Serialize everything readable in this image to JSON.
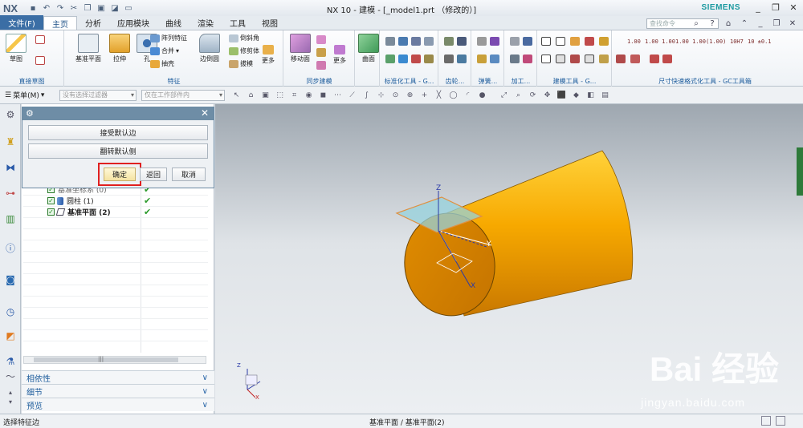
{
  "app": {
    "logo": "NX",
    "window_title": "NX 10 - 建模 - [_model1.prt （修改的）]",
    "brand": "SIEMENS",
    "search_placeholder": "查找命令"
  },
  "tabs": {
    "file": "文件(F)",
    "items": [
      "主页",
      "分析",
      "应用模块",
      "曲线",
      "渲染",
      "工具",
      "视图"
    ],
    "active": "主页"
  },
  "ribbon": {
    "sketch": {
      "btn1": "草图",
      "label": "直接草图"
    },
    "feature": {
      "datum_plane": "基准平面",
      "extrude": "拉伸",
      "hole": "孔",
      "pattern": "阵列特征",
      "unite": "合并",
      "shell": "抽壳",
      "edge_blend": "边倒圆",
      "chamfer": "倒斜角",
      "trim_body": "修剪体",
      "draft": "拔模",
      "more": "更多",
      "label": "特征"
    },
    "sync": {
      "move_face": "移动面",
      "more": "更多",
      "label": "同步建模"
    },
    "surface": {
      "face": "曲面"
    },
    "groups": {
      "std_tools": "标准化工具 - G...",
      "gear": "齿轮...",
      "spring": "弹簧...",
      "machining": "加工...",
      "modeling_tools": "建模工具 - G...",
      "dimension": "尺寸快速格式化工具 - GC工具箱"
    },
    "dim_labels": [
      "1.00",
      "1.00 1.00",
      "1.00 1.00",
      "1.00 1.00",
      "1.00 1.00",
      "(1.00)",
      "10H7",
      "10H7 10H7",
      "10 ±0.1"
    ]
  },
  "filterbar": {
    "menu": "菜单(M)",
    "filter1": "没有选择过滤器",
    "filter2": "仅在工作部件内"
  },
  "dialog": {
    "accept_default_edge": "接受默认边",
    "flip_default_side": "翻转默认侧",
    "ok": "确定",
    "back": "返回",
    "cancel": "取消"
  },
  "tree": {
    "rows": [
      {
        "name": "基准坐标系 (0)",
        "bold": false
      },
      {
        "name": "圆柱 (1)",
        "bold": false
      },
      {
        "name": "基准平面 (2)",
        "bold": true
      }
    ]
  },
  "navsections": [
    "相依性",
    "细节",
    "预览"
  ],
  "status": {
    "left": "选择特征边",
    "center": "基准平面 / 基准平面(2)"
  },
  "watermark": {
    "main": "Bai  经验",
    "sub": "jingyan.baidu.com"
  },
  "colors": {
    "accent": "#3b6ea5",
    "cylinder": "#f5a800",
    "plane": "#9fd0d8",
    "highlight": "#e02020"
  }
}
